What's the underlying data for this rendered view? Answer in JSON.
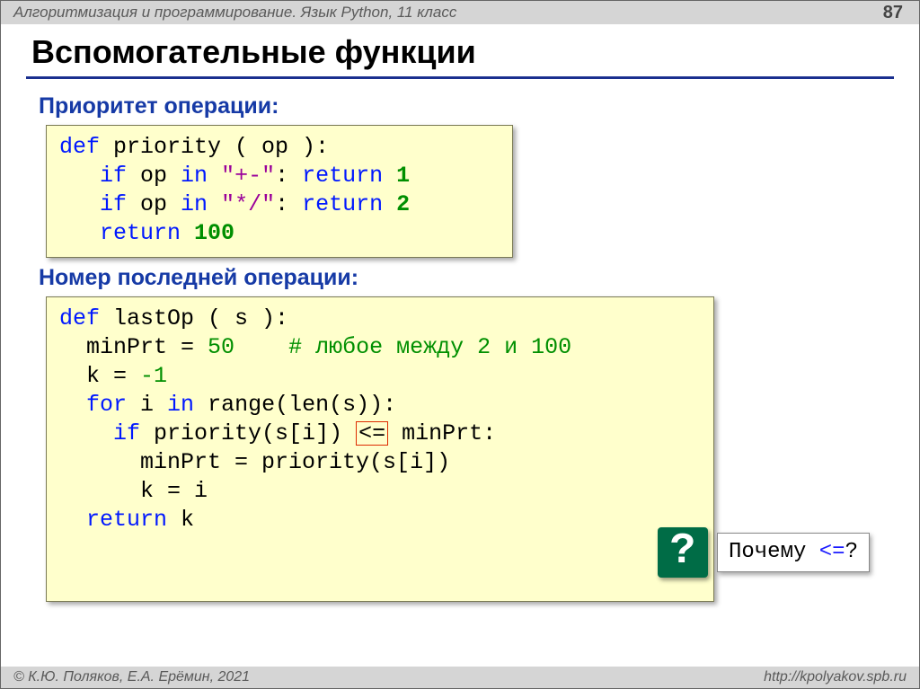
{
  "header": {
    "course": "Алгоритмизация и программирование. Язык Python, 11 класс",
    "page": "87"
  },
  "title": "Вспомогательные функции",
  "section1": {
    "heading": "Приоритет операции:",
    "code": {
      "l1": {
        "kw": "def",
        "rest": " priority ( op ):"
      },
      "l2": {
        "indent": "   ",
        "kw": "if",
        "mid1": " op ",
        "kw2": "in",
        "mid2": " ",
        "str": "\"+-\"",
        "mid3": ": ",
        "kw3": "return",
        "sp": " ",
        "num": "1"
      },
      "l3": {
        "indent": "   ",
        "kw": "if",
        "mid1": " op ",
        "kw2": "in",
        "mid2": " ",
        "str": "\"*/\"",
        "mid3": ": ",
        "kw3": "return",
        "sp": " ",
        "num": "2"
      },
      "l4": {
        "indent": "   ",
        "kw": "return",
        "sp": " ",
        "num": "100"
      }
    }
  },
  "section2": {
    "heading": "Номер последней операции:",
    "code": {
      "l1": {
        "kw": "def",
        "rest": " lastOp ( s ):"
      },
      "l2": {
        "indent": "  ",
        "txt1": "minPrt = ",
        "num": "50",
        "gap": "    ",
        "cmt": "# любое между 2 и 100"
      },
      "l3": {
        "indent": "  ",
        "txt1": "k = ",
        "num": "-1"
      },
      "l4": {
        "indent": "  ",
        "kw": "for",
        "txt1": " i ",
        "kw2": "in",
        "txt2": " range(len(s)):"
      },
      "l5": {
        "indent": "    ",
        "kw": "if",
        "txt": " priority(s[i]) ",
        "op": "<=",
        "txt2": " minPrt:"
      },
      "l6": {
        "indent": "      ",
        "txt": "minPrt = priority(s[i])"
      },
      "l7": {
        "indent": "      ",
        "txt": "k = i"
      },
      "l8": {
        "indent": "  ",
        "kw": "return",
        "txt": " k"
      }
    }
  },
  "callout": {
    "badge": "?",
    "text": "Почему ",
    "op": "<=",
    "suffix": "?"
  },
  "footer": {
    "left": "© К.Ю. Поляков, Е.А. Ерёмин, 2021",
    "right": "http://kpolyakov.spb.ru"
  }
}
